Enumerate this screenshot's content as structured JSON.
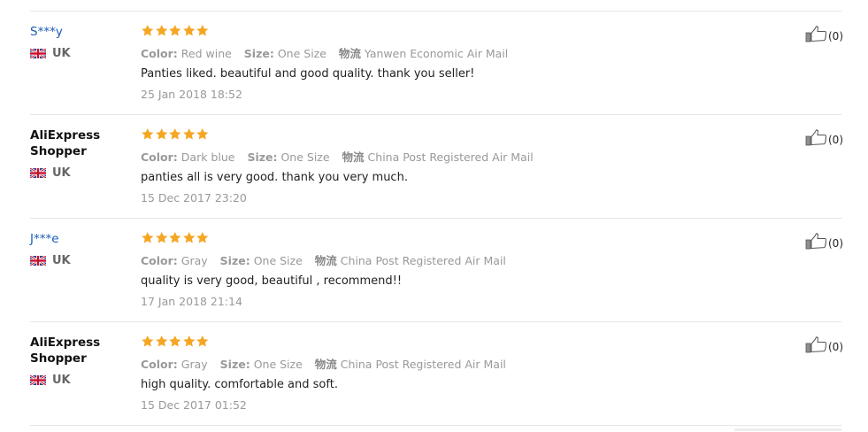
{
  "reviews": [
    {
      "user": "S***y",
      "user_style": "link",
      "country": "UK",
      "stars": 5,
      "color_label": "Color:",
      "color_value": "Red wine",
      "size_label": "Size:",
      "size_value": "One Size",
      "shipping_label": "物流",
      "shipping_value": "Yanwen Economic Air Mail",
      "text": "Panties liked. beautiful and good quality. thank you seller!",
      "date": "25 Jan 2018 18:52",
      "likes": "(0)"
    },
    {
      "user": "AliExpress Shopper",
      "user_style": "plain",
      "country": "UK",
      "stars": 5,
      "color_label": "Color:",
      "color_value": "Dark blue",
      "size_label": "Size:",
      "size_value": "One Size",
      "shipping_label": "物流",
      "shipping_value": "China Post Registered Air Mail",
      "text": "panties all is very good. thank you very much.",
      "date": "15 Dec 2017 23:20",
      "likes": "(0)"
    },
    {
      "user": "J***e",
      "user_style": "link",
      "country": "UK",
      "stars": 5,
      "color_label": "Color:",
      "color_value": "Gray",
      "size_label": "Size:",
      "size_value": "One Size",
      "shipping_label": "物流",
      "shipping_value": "China Post Registered Air Mail",
      "text": "quality is very good, beautiful , recommend!!",
      "date": "17 Jan 2018 21:14",
      "likes": "(0)"
    },
    {
      "user": "AliExpress Shopper",
      "user_style": "plain",
      "country": "UK",
      "stars": 5,
      "color_label": "Color:",
      "color_value": "Gray",
      "size_label": "Size:",
      "size_value": "One Size",
      "shipping_label": "物流",
      "shipping_value": "China Post Registered Air Mail",
      "text": "high quality. comfortable and soft.",
      "date": "15 Dec 2017 01:52",
      "likes": "(0)"
    }
  ],
  "colors": {
    "star": "#f5a623",
    "link_user": "#1a5cb8",
    "muted": "#999999",
    "divider": "#e6e6e6"
  },
  "icons": {
    "flag": "uk-flag-icon",
    "rating": "star-icon",
    "helpful": "thumbs-up-icon"
  }
}
